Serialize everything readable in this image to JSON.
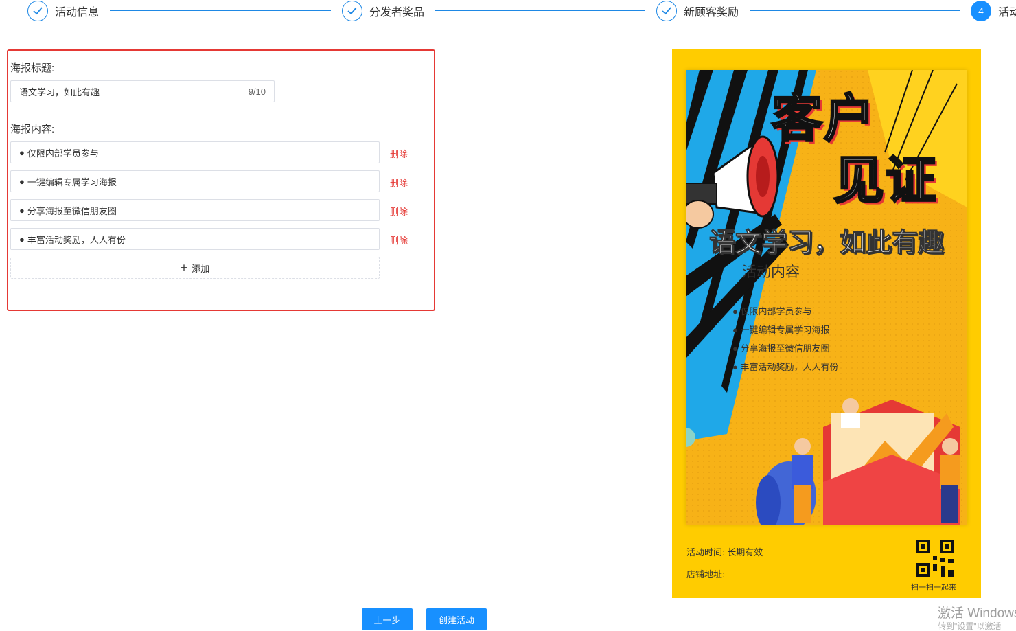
{
  "steps": [
    {
      "label": "活动信息",
      "status": "done"
    },
    {
      "label": "分发者奖品",
      "status": "done"
    },
    {
      "label": "新顾客奖励",
      "status": "done"
    },
    {
      "label": "活动",
      "status": "active",
      "number": "4"
    }
  ],
  "form": {
    "title_label": "海报标题:",
    "title_value": "语文学习，如此有趣",
    "title_count": "9/10",
    "content_label": "海报内容:",
    "content_items": [
      "仅限内部学员参与",
      "一键编辑专属学习海报",
      "分享海报至微信朋友圈",
      "丰富活动奖励，人人有份"
    ],
    "bullet": "●",
    "delete_label": "删除",
    "add_label": "添加"
  },
  "poster": {
    "heading_line1": "客户",
    "heading_line2": "见证",
    "title": "语文学习，如此有趣",
    "subtitle": "活动内容",
    "items": [
      "● 仅限内部学员参与",
      "● 一键编辑专属学习海报",
      "● 分享海报至微信朋友圈",
      "● 丰富活动奖励，人人有份"
    ],
    "time_label": "活动时间:",
    "time_value": "长期有效",
    "address_label": "店铺地址:",
    "qr_caption": "扫一扫一起来"
  },
  "buttons": {
    "prev": "上一步",
    "create": "创建活动"
  },
  "watermark": {
    "line1": "激活 Windows",
    "line2": "转到\"设置\"以激活"
  },
  "colors": {
    "primary": "#1890ff",
    "danger": "#e53935",
    "poster_bg": "#ffcc00",
    "poster_blue": "#1fa8e8"
  }
}
